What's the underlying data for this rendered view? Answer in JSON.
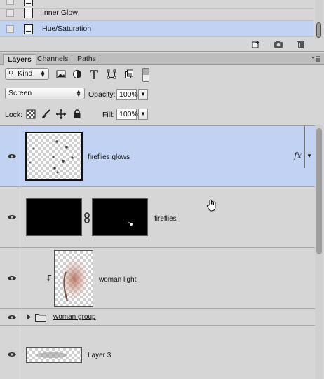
{
  "history": {
    "items": [
      {
        "label": ""
      },
      {
        "label": "Inner Glow"
      },
      {
        "label": "Hue/Saturation"
      }
    ]
  },
  "tabs": [
    {
      "label": "Layers"
    },
    {
      "label": "Channels"
    },
    {
      "label": "Paths"
    }
  ],
  "filter": {
    "kind_label": "Kind"
  },
  "blend": {
    "mode": "Screen",
    "opacity_label": "Opacity:",
    "opacity_value": "100%",
    "fill_label": "Fill:",
    "fill_value": "100%",
    "lock_label": "Lock:"
  },
  "layers": [
    {
      "name": "fireflies glows",
      "fx": "fx"
    },
    {
      "name": "fireflies"
    },
    {
      "name": "woman light"
    },
    {
      "name": "woman group"
    },
    {
      "name": "Layer 3"
    }
  ],
  "colors": {
    "selected": "#c1d2f2",
    "panel": "#d6d6d6"
  }
}
